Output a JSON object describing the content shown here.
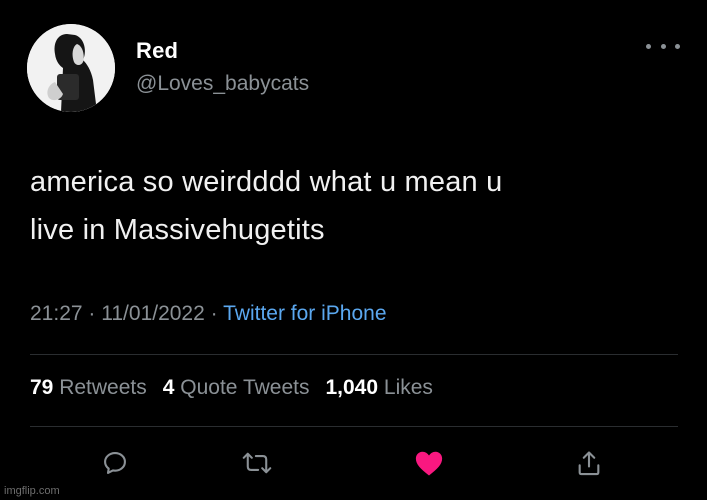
{
  "user": {
    "display_name": "Red",
    "handle": "@Loves_babycats"
  },
  "tweet": {
    "text_line1": "america so weirdddd what u mean u",
    "text_line2": "live in Massivehugetits",
    "time": "21:27",
    "date": "11/01/2022",
    "separator": "·",
    "source": "Twitter for iPhone"
  },
  "stats": {
    "retweets_count": "79",
    "retweets_label": "Retweets",
    "quotes_count": "4",
    "quotes_label": "Quote Tweets",
    "likes_count": "1,040",
    "likes_label": "Likes"
  },
  "actions": {
    "icons": [
      "reply-icon",
      "retweet-icon",
      "like-icon",
      "share-icon"
    ],
    "like_color": "#f91880",
    "icon_color": "#8b9196"
  },
  "watermark": "imgflip.com"
}
